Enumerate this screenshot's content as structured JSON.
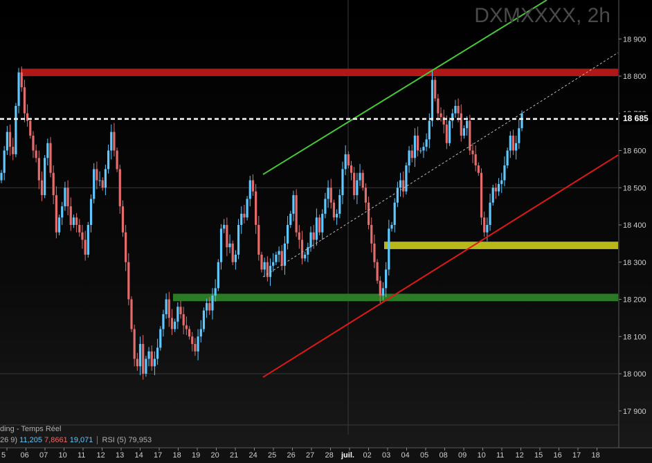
{
  "header": {
    "ticker": "DXMXXXX, 2h"
  },
  "status": {
    "feed": "ding - Temps Réel",
    "indicator_prefix": "26 9)",
    "macd_values": [
      "11,205",
      "7,8661",
      "19,071"
    ],
    "rsi_label": "RSI (5)",
    "rsi_value": "79,953"
  },
  "last_price_label": "18 685",
  "colors": {
    "up_candle": "#5fc8ff",
    "down_candle": "#e46c6c",
    "resistance_zone": "#b01818",
    "support_zone_yellow": "#b8b81a",
    "support_zone_green": "#2a7a26",
    "channel_upper": "#48c838",
    "channel_lower": "#e01818",
    "grid": "#3a3a3a"
  },
  "chart_data": {
    "type": "candlestick",
    "title": "DXMXXXX, 2h",
    "y_ticks": [
      17900,
      18000,
      18100,
      18200,
      18300,
      18400,
      18500,
      18600,
      18700,
      18800,
      18900
    ],
    "y_tick_labels": [
      "17 900",
      "18 000",
      "18 100",
      "18 200",
      "18 300",
      "18 400",
      "18 500",
      "18 600",
      "18 700",
      "18 800",
      "18 900"
    ],
    "ylim": [
      17820,
      19000
    ],
    "x_tick_labels": [
      "5",
      "06",
      "07",
      "10",
      "11",
      "12",
      "13",
      "14",
      "17",
      "18",
      "19",
      "20",
      "21",
      "24",
      "25",
      "26",
      "27",
      "28",
      "juil.",
      "02",
      "03",
      "04",
      "05",
      "08",
      "09",
      "10",
      "11",
      "12",
      "15",
      "16",
      "17",
      "18"
    ],
    "last_price": 18685,
    "zones": [
      {
        "name": "resistance",
        "from": 18800,
        "to": 18820
      },
      {
        "name": "support-yellow",
        "from": 18335,
        "to": 18355
      },
      {
        "name": "support-green",
        "from": 18195,
        "to": 18215
      }
    ],
    "closes": [
      18540,
      18600,
      18650,
      18610,
      18590,
      18720,
      18810,
      18770,
      18700,
      18680,
      18640,
      18600,
      18580,
      18520,
      18480,
      18580,
      18620,
      18540,
      18480,
      18380,
      18420,
      18450,
      18500,
      18450,
      18400,
      18420,
      18400,
      18380,
      18360,
      18320,
      18400,
      18470,
      18550,
      18520,
      18520,
      18500,
      18550,
      18600,
      18650,
      18600,
      18550,
      18450,
      18380,
      18300,
      18200,
      18120,
      18040,
      18020,
      18080,
      18000,
      18040,
      18060,
      18020,
      18040,
      18070,
      18120,
      18160,
      18200,
      18150,
      18120,
      18140,
      18180,
      18160,
      18130,
      18120,
      18100,
      18080,
      18060,
      18100,
      18120,
      18170,
      18190,
      18170,
      18210,
      18230,
      18300,
      18390,
      18400,
      18340,
      18350,
      18300,
      18320,
      18400,
      18430,
      18420,
      18470,
      18520,
      18490,
      18400,
      18320,
      18280,
      18300,
      18260,
      18290,
      18300,
      18320,
      18330,
      18290,
      18350,
      18400,
      18430,
      18480,
      18380,
      18360,
      18310,
      18320,
      18340,
      18380,
      18360,
      18420,
      18380,
      18430,
      18470,
      18500,
      18460,
      18420,
      18430,
      18480,
      18550,
      18590,
      18560,
      18540,
      18480,
      18520,
      18540,
      18500,
      18460,
      18400,
      18350,
      18300,
      18250,
      18210,
      18230,
      18280,
      18390,
      18400,
      18460,
      18500,
      18520,
      18490,
      18560,
      18600,
      18580,
      18640,
      18600,
      18600,
      18610,
      18630,
      18680,
      18790,
      18740,
      18700,
      18690,
      18670,
      18620,
      18680,
      18700,
      18720,
      18700,
      18640,
      18660,
      18680,
      18600,
      18590,
      18560,
      18540,
      18420,
      18380,
      18400,
      18460,
      18500,
      18490,
      18510,
      18520,
      18560,
      18600,
      18640,
      18600,
      18620,
      18660,
      18700
    ]
  }
}
